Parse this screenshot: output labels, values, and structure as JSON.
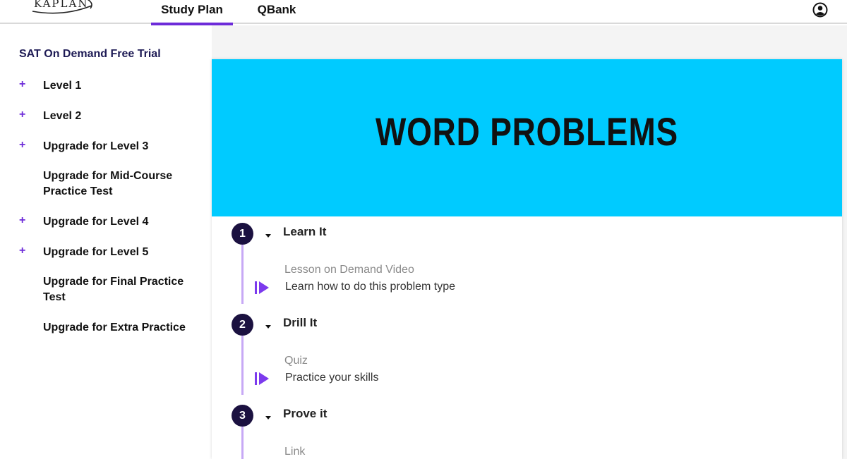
{
  "header": {
    "logo_text": "KAPLAN",
    "tabs": [
      {
        "label": "Study Plan",
        "active": true
      },
      {
        "label": "QBank",
        "active": false
      }
    ],
    "account_icon": "user-circle-icon"
  },
  "sidebar": {
    "course_title": "SAT On Demand Free Trial",
    "items": [
      {
        "label": "Level 1",
        "expandable": true
      },
      {
        "label": "Level 2",
        "expandable": true
      },
      {
        "label": "Upgrade for Level 3",
        "expandable": true
      },
      {
        "label": "Upgrade for Mid-Course Practice Test",
        "expandable": false
      },
      {
        "label": "Upgrade for Level 4",
        "expandable": true
      },
      {
        "label": "Upgrade for Level 5",
        "expandable": true
      },
      {
        "label": "Upgrade for Final Practice Test",
        "expandable": false
      },
      {
        "label": "Upgrade for Extra Practice",
        "expandable": false
      }
    ],
    "plus_symbol": "+"
  },
  "main": {
    "hero_title": "WORD PROBLEMS",
    "hero_color": "#00cbff",
    "steps": [
      {
        "number": "1",
        "title": "Learn It",
        "item_type": "Lesson on Demand Video",
        "item_desc": "Learn how to do this problem type"
      },
      {
        "number": "2",
        "title": "Drill It",
        "item_type": "Quiz",
        "item_desc": "Practice your skills"
      },
      {
        "number": "3",
        "title": "Prove it",
        "item_type": "Link",
        "item_desc": ""
      }
    ]
  },
  "colors": {
    "accent": "#6d2bd9",
    "step_circle": "#1b1140",
    "timeline": "#c7a9f5",
    "course_title": "#1e1b55"
  }
}
